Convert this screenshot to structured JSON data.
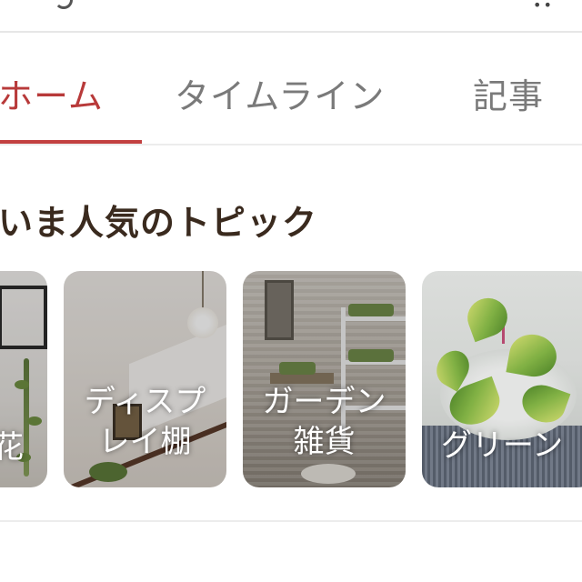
{
  "tabs": [
    {
      "label": "ホーム",
      "active": true
    },
    {
      "label": "タイムライン",
      "active": false
    },
    {
      "label": "記事",
      "active": false
    }
  ],
  "section": {
    "title": "いま人気のトピック"
  },
  "topics": [
    {
      "label_line1": "花",
      "label_line2": ""
    },
    {
      "label_line1": "ディスプ",
      "label_line2": "レイ棚"
    },
    {
      "label_line1": "ガーデン",
      "label_line2": "雑貨"
    },
    {
      "label_line1": "グリーン",
      "label_line2": ""
    }
  ],
  "colors": {
    "accent": "#c24040",
    "inactive_tab": "#7a7a7a",
    "title": "#3a2a1e"
  },
  "icons": [
    "search-icon",
    "more-icon"
  ]
}
